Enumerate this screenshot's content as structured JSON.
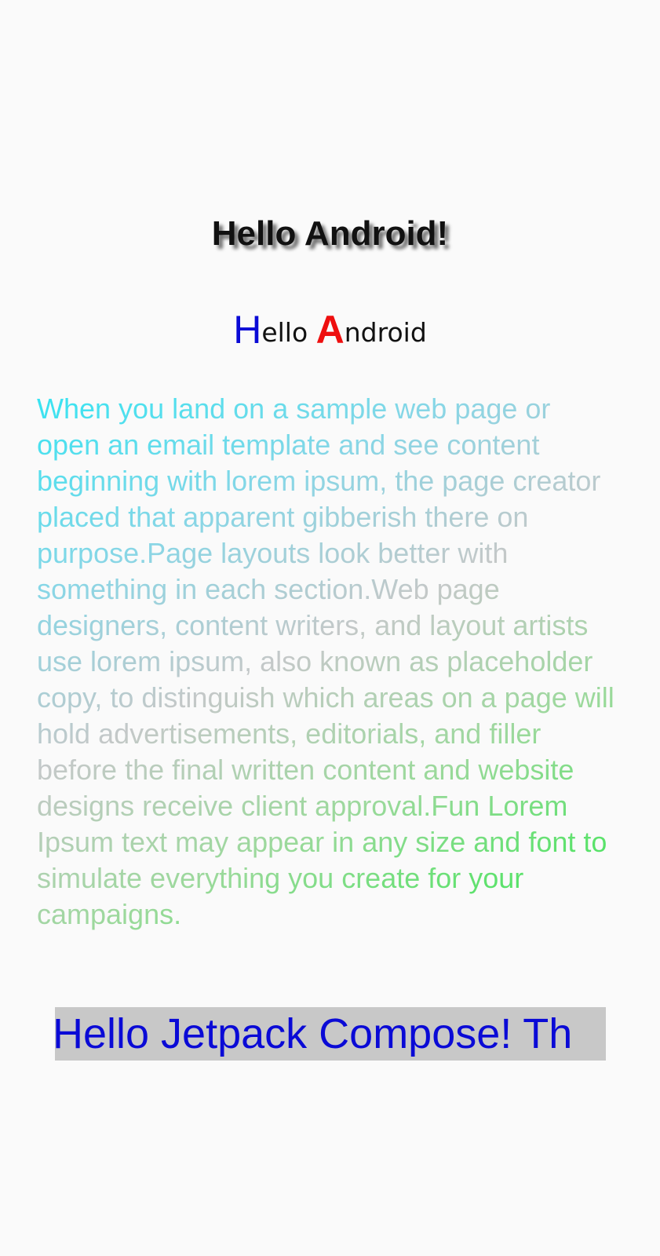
{
  "shadow_title": {
    "text": "Hello Android!"
  },
  "styled_hello": {
    "part1_initial": "H",
    "part1_rest": "ello ",
    "part2_initial": "A",
    "part2_rest": "ndroid",
    "colors": {
      "initial_h": "#0a0ad6",
      "initial_a": "#ee0f0f"
    }
  },
  "gradient_paragraph": {
    "text": "When you land on a sample web page or open an email template and see content beginning with lorem ipsum, the page creator placed that apparent gibberish there on purpose.Page layouts look better with something in each section.Web page designers, content writers, and layout artists use lorem ipsum, also known as placeholder copy, to distinguish which areas on a page will hold advertisements, editorials, and filler before the final written content and website designs receive client approval.Fun Lorem Ipsum text may appear in any size and font to simulate everything you create for your campaigns.",
    "gradient_colors": [
      "#33e4f2",
      "#88d6e6",
      "#c4c8c8",
      "#9bd99b",
      "#2fe84a"
    ]
  },
  "marquee": {
    "text": "Hello Jetpack Compose! Th",
    "text_color": "#0a0ad6",
    "background": "#c8c8c8"
  },
  "colors": {
    "background": "#fafafa"
  }
}
